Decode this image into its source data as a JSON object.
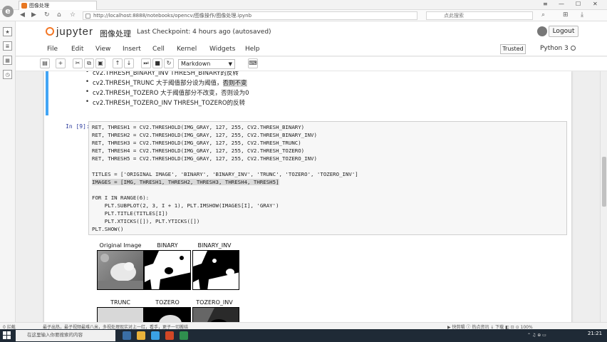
{
  "browser": {
    "tab_title": "图像处理",
    "url": "http://localhost:8888/notebooks/opencv/图像操作/图像处理.ipynb",
    "search_placeholder": "点此搜索",
    "status_left": "0 拦截",
    "status_center": "最子出热，最子视频最难八米，多视处理现实对上一红，看手，更子一切搬结",
    "status_right": "▶ 快剪辑  ⓘ 热点资讯  ↓ 下载  ◧  ⊡  ⊙  100%"
  },
  "jupyter": {
    "logo_text": "jupyter",
    "notebook_name": "图像处理",
    "checkpoint": "Last Checkpoint: 4 hours ago  (autosaved)",
    "logout_label": "Logout",
    "menu": [
      "File",
      "Edit",
      "View",
      "Insert",
      "Cell",
      "Kernel",
      "Widgets",
      "Help"
    ],
    "trusted_label": "Trusted",
    "kernel_name": "Python 3",
    "cell_type": "Markdown"
  },
  "toolbar_icons": [
    "save-icon",
    "plus-icon",
    "cut-icon",
    "copy-icon",
    "paste-icon",
    "up-arrow-icon",
    "down-arrow-icon",
    "run-icon",
    "stop-icon",
    "restart-icon",
    "fast-forward-icon",
    "keyboard-icon"
  ],
  "markdown_cell": {
    "bullets": [
      "cv2.THRESH_BINARY_INV THRESH_BINARY的反转",
      "cv2.THRESH_TRUNC 大于阈值部分设为阈值，否则不变",
      "cv2.THRESH_TOZERO 大于阈值部分不改变，否则设为0",
      "cv2.THRESH_TOZERO_INV THRESH_TOZERO的反转"
    ]
  },
  "code_cell": {
    "prompt": "In [9]:",
    "lines": [
      "RET, THRESH1 = CV2.THRESHOLD(IMG_GRAY, 127, 255, CV2.THRESH_BINARY)",
      "RET, THRESH2 = CV2.THRESHOLD(IMG_GRAY, 127, 255, CV2.THRESH_BINARY_INV)",
      "RET, THRESH3 = CV2.THRESHOLD(IMG_GRAY, 127, 255, CV2.THRESH_TRUNC)",
      "RET, THRESH4 = CV2.THRESHOLD(IMG_GRAY, 127, 255, CV2.THRESH_TOZERO)",
      "RET, THRESH5 = CV2.THRESHOLD(IMG_GRAY, 127, 255, CV2.THRESH_TOZERO_INV)",
      "",
      "TITLES = ['ORIGINAL IMAGE', 'BINARY', 'BINARY_INV', 'TRUNC', 'TOZERO', 'TOZERO_INV']",
      "IMAGES = [IMG, THRESH1, THRESH2, THRESH3, THRESH4, THRESH5]",
      "",
      "FOR I IN RANGE(6):",
      "    PLT.SUBPLOT(2, 3, I + 1), PLT.IMSHOW(IMAGES[I], 'GRAY')",
      "    PLT.TITLE(TITLES[I])",
      "    PLT.XTICKS([]), PLT.YTICKS([])",
      "PLT.SHOW()"
    ]
  },
  "output": {
    "titles": [
      "Original Image",
      "BINARY",
      "BINARY_INV",
      "TRUNC",
      "TOZERO",
      "TOZERO_INV"
    ]
  },
  "taskbar": {
    "search_placeholder": "在这里输入你要搜索的内容",
    "time": "21:21"
  }
}
